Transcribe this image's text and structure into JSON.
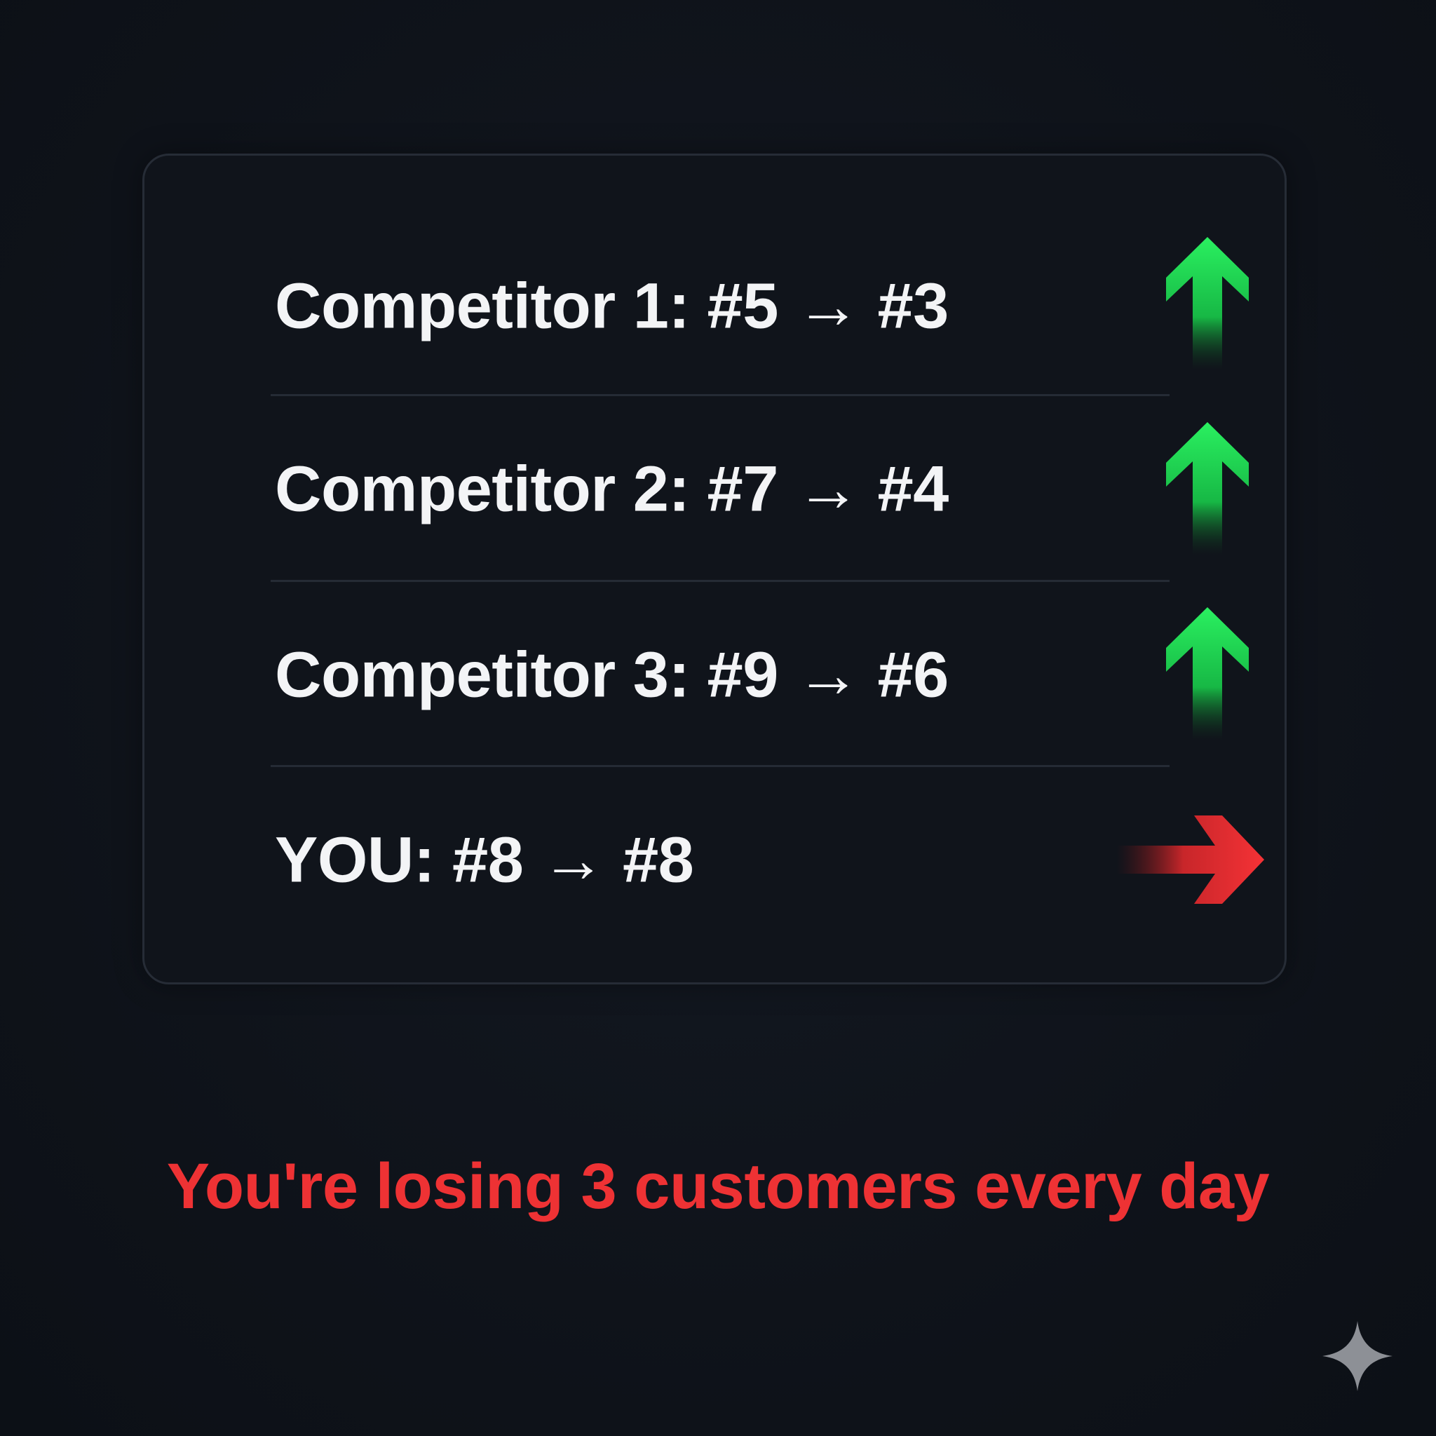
{
  "rows": [
    {
      "label": "Competitor 1: #5 → #3",
      "trend": "up",
      "trend_icon": "arrow-up-icon"
    },
    {
      "label": "Competitor 2: #7 → #4",
      "trend": "up",
      "trend_icon": "arrow-up-icon"
    },
    {
      "label": "Competitor 3: #9 → #6",
      "trend": "up",
      "trend_icon": "arrow-up-icon"
    },
    {
      "label": "YOU: #8 → #8",
      "trend": "flat",
      "trend_icon": "arrow-right-icon"
    }
  ],
  "tagline": "You're losing 3 customers every day",
  "colors": {
    "up": "#22e05a",
    "flat": "#ee3234",
    "tagline": "#ee3234",
    "text": "#f3f4f6",
    "background": "#0f131a"
  },
  "watermark_icon": "sparkle-icon"
}
